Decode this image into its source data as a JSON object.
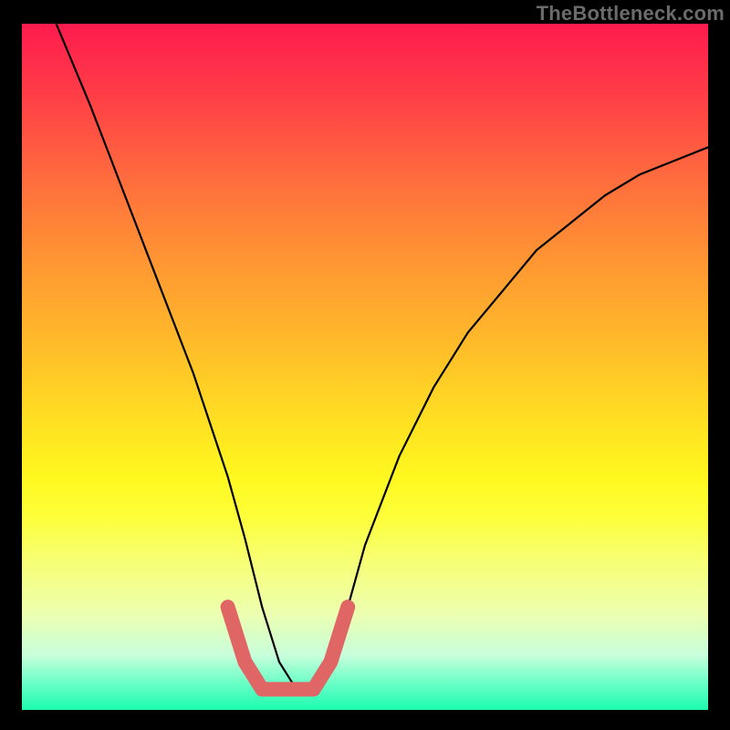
{
  "watermark": "TheBottleneck.com",
  "chart_data": {
    "type": "line",
    "title": "",
    "xlabel": "",
    "ylabel": "",
    "xlim": [
      0,
      1
    ],
    "ylim": [
      0,
      1
    ],
    "series": [
      {
        "name": "curve",
        "x": [
          0.05,
          0.1,
          0.15,
          0.2,
          0.25,
          0.3,
          0.325,
          0.35,
          0.375,
          0.4,
          0.425,
          0.45,
          0.475,
          0.5,
          0.55,
          0.6,
          0.65,
          0.7,
          0.75,
          0.8,
          0.85,
          0.9,
          0.95,
          1.0
        ],
        "y": [
          1.0,
          0.88,
          0.75,
          0.62,
          0.49,
          0.34,
          0.25,
          0.15,
          0.07,
          0.03,
          0.03,
          0.07,
          0.15,
          0.24,
          0.37,
          0.47,
          0.55,
          0.61,
          0.67,
          0.71,
          0.75,
          0.78,
          0.8,
          0.82
        ]
      },
      {
        "name": "highlight",
        "x": [
          0.3,
          0.325,
          0.35,
          0.375,
          0.4,
          0.425,
          0.45,
          0.475
        ],
        "y": [
          0.15,
          0.07,
          0.03,
          0.03,
          0.03,
          0.03,
          0.07,
          0.15
        ]
      }
    ],
    "colors": {
      "curve": "#000000",
      "highlight": "#e06666"
    }
  }
}
